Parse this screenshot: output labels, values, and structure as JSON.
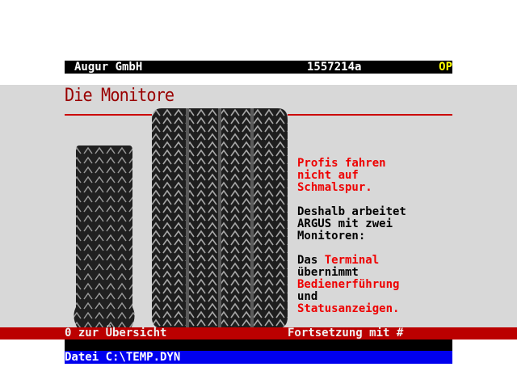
{
  "header": {
    "company": "Augur GmbH",
    "code": "1557214a",
    "flag": "OP"
  },
  "page": {
    "title": "Die Monitore"
  },
  "content": {
    "intro_line1": "Profis fahren",
    "intro_line2": "nicht auf",
    "intro_line3": "Schmalspur.",
    "para2_line1": "Deshalb arbeitet",
    "para2_line2": "ARGUS mit zwei",
    "para2_line3": "Monitoren:",
    "para3_das": "Das ",
    "para3_terminal": "Terminal",
    "para3_line2": "übernimmt",
    "para3_line3": "Bedienerführung",
    "para3_line4": "und",
    "para3_line5": "Statusanzeigen."
  },
  "status": {
    "left": "0 zur Übersicht",
    "right": "Fortsetzung mit #"
  },
  "file": {
    "label": "Datei C:\\TEMP.DYN"
  },
  "colors": {
    "title": "#990000",
    "accent_red": "#ee0000",
    "status_bar": "#bb0000",
    "file_bar": "#0000ee",
    "flag": "#ffff00"
  }
}
